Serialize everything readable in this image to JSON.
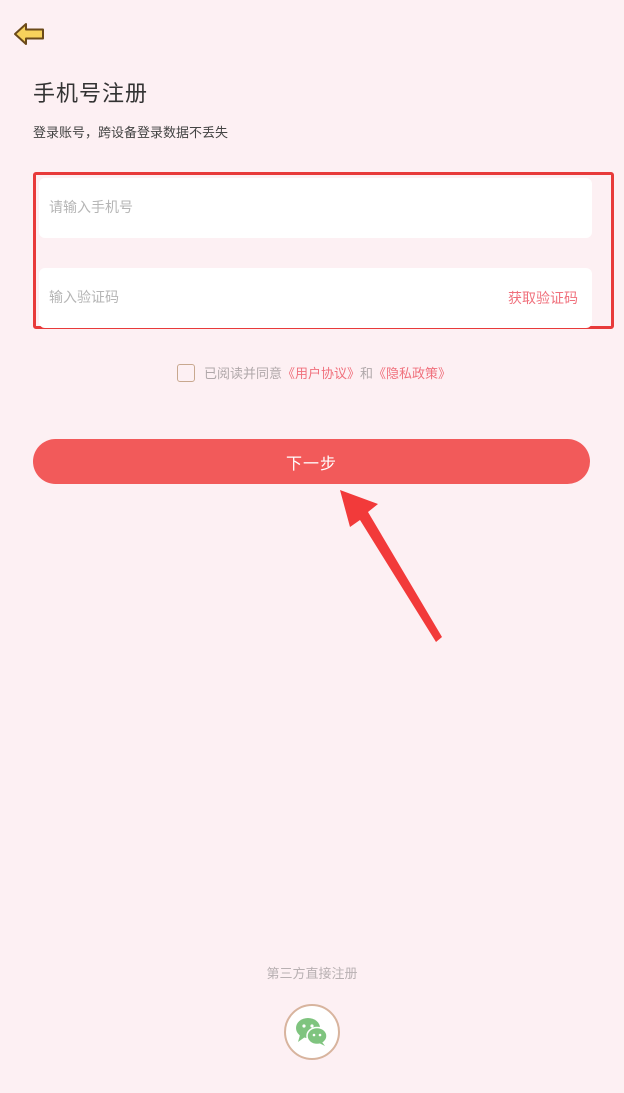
{
  "header": {
    "back_icon": "arrow-left-icon",
    "title": "手机号注册",
    "subtitle": "登录账号，跨设备登录数据不丢失"
  },
  "form": {
    "phone_placeholder": "请输入手机号",
    "phone_value": "",
    "code_placeholder": "输入验证码",
    "code_value": "",
    "get_code_label": "获取验证码"
  },
  "agreement": {
    "checked": false,
    "prefix": "已阅读并同意",
    "user_agreement": "《用户协议》",
    "and": "和",
    "privacy_policy": "《隐私政策》"
  },
  "next_button_label": "下一步",
  "third_party": {
    "label": "第三方直接注册",
    "wechat_icon": "wechat-icon"
  },
  "colors": {
    "background": "#fdf0f3",
    "primary": "#f25a5a",
    "link": "#f0707c",
    "annotation_red": "#e83a3a",
    "back_arrow": "#f7d25c",
    "wechat_green": "#7fc47f"
  }
}
